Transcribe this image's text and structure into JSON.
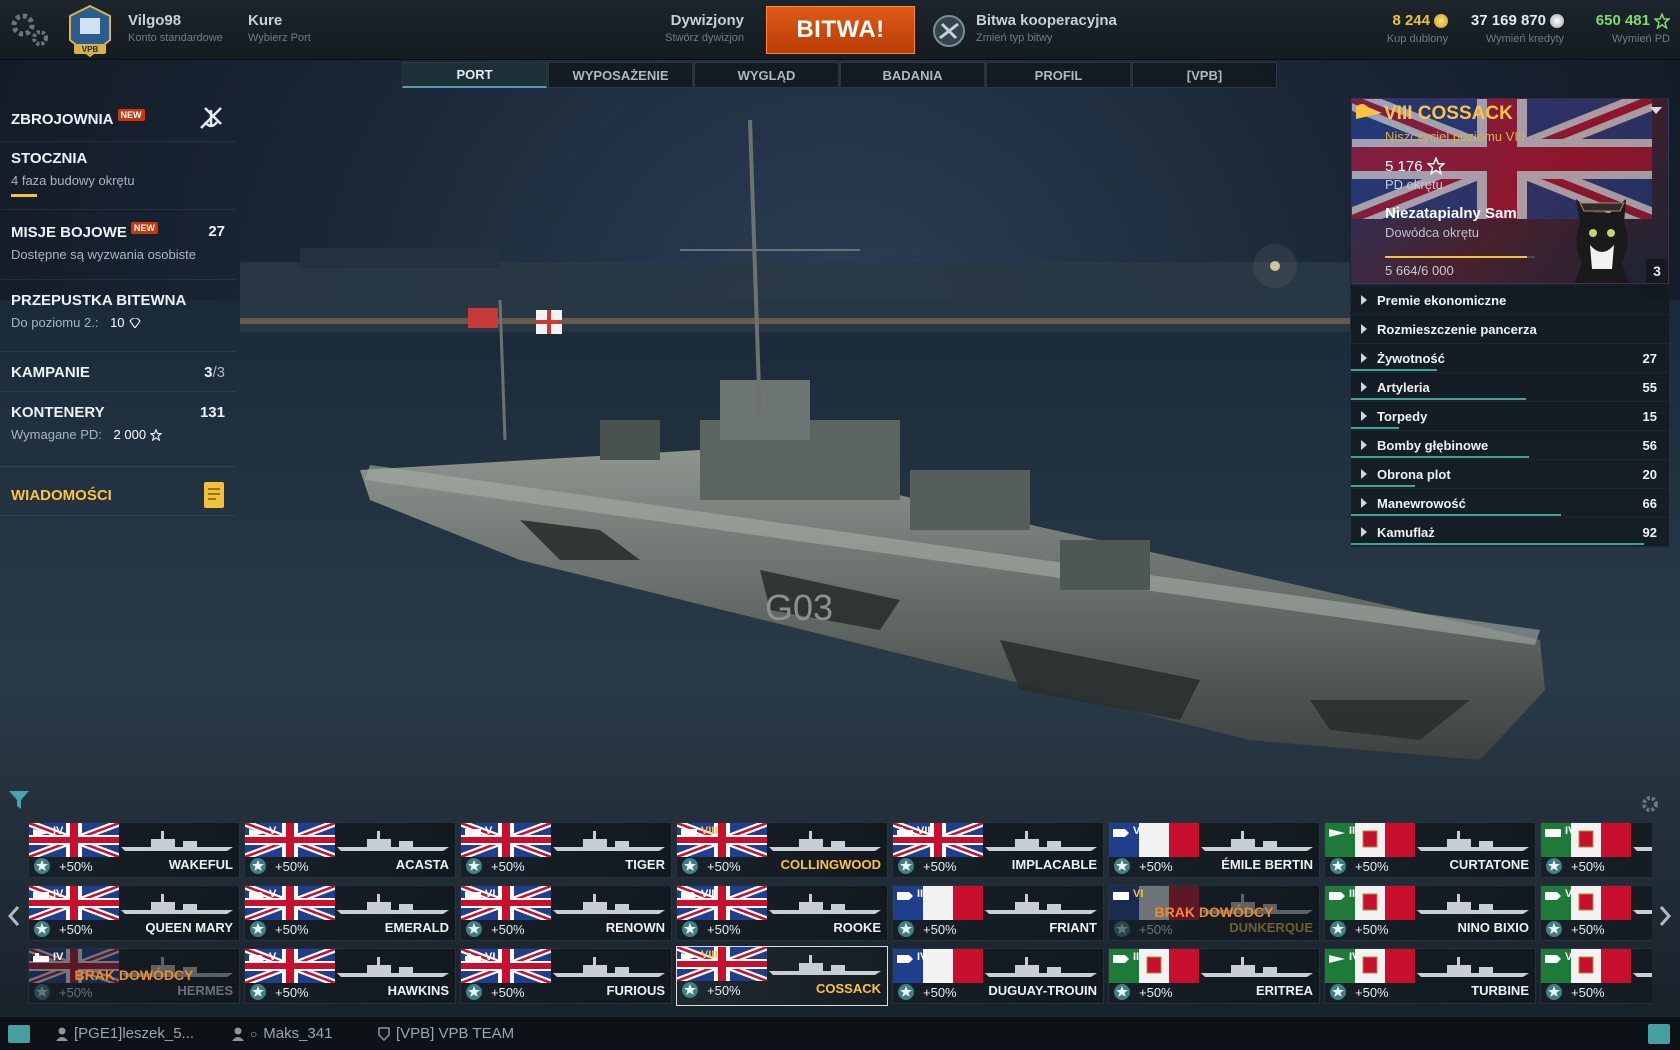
{
  "header": {
    "user": {
      "name": "Vilgo98",
      "sub": "Konto standardowe"
    },
    "port": {
      "name": "Kure",
      "sub": "Wybierz Port"
    },
    "division": {
      "label": "Dywizjony",
      "sub": "Stwórz dywizjon"
    },
    "battle_button": "BITWA!",
    "battle_type": {
      "label": "Bitwa kooperacyjna",
      "sub": "Zmień typ bitwy"
    },
    "currencies": [
      {
        "value": "8 244",
        "sub": "Kup dublony",
        "color": "#f2c13b",
        "icon": "doubloon-icon"
      },
      {
        "value": "37 169 870",
        "sub": "Wymień kredyty",
        "color": "#e6e9ec",
        "icon": "credits-icon"
      },
      {
        "value": "650 481",
        "sub": "Wymień PD",
        "color": "#7fdc6c",
        "icon": "free-xp-star-icon"
      }
    ],
    "clan_tag": "VPB"
  },
  "tabs": [
    "PORT",
    "WYPOSAŻENIE",
    "WYGLĄD",
    "BADANIA",
    "PROFIL",
    "[VPB]"
  ],
  "left_menu": {
    "zbrojownia": {
      "title": "ZBROJOWNIA",
      "badge": "NEW"
    },
    "stocznia": {
      "title": "STOCZNIA",
      "sub": "4 faza budowy okrętu"
    },
    "misje": {
      "title": "MISJE BOJOWE",
      "badge": "NEW",
      "count": "27",
      "sub": "Dostępne są wyzwania osobiste"
    },
    "przepustka": {
      "title": "PRZEPUSTKA BITEWNA",
      "sub_label": "Do poziomu 2.:",
      "sub_value": "10"
    },
    "kampanie": {
      "title": "KAMPANIE",
      "count": "3",
      "total": "/3"
    },
    "kontenery": {
      "title": "KONTENERY",
      "count": "131",
      "sub_label": "Wymagane PD:",
      "sub_value": "2 000"
    },
    "wiadomosci": {
      "title": "WIADOMOŚCI"
    }
  },
  "ship_panel": {
    "name": "VIII COSSACK",
    "class": "Niszczyciel poziomu VIII",
    "pd_value": "5 176",
    "pd_label": "PD okrętu",
    "commander_name": "Niezatapialny Sam",
    "commander_role": "Dowódca okrętu",
    "commander_xp": "5 664/6 000",
    "commander_xp_fraction": 0.944,
    "commander_level": "3",
    "stats": [
      {
        "label": "Premie ekonomiczne",
        "value": "",
        "fraction": 0
      },
      {
        "label": "Rozmieszczenie pancerza",
        "value": "",
        "fraction": 0
      },
      {
        "label": "Żywotność",
        "value": "27",
        "fraction": 0.27
      },
      {
        "label": "Artyleria",
        "value": "55",
        "fraction": 0.55
      },
      {
        "label": "Torpedy",
        "value": "15",
        "fraction": 0.15
      },
      {
        "label": "Bomby głębinowe",
        "value": "56",
        "fraction": 0.56
      },
      {
        "label": "Obrona plot",
        "value": "20",
        "fraction": 0.2
      },
      {
        "label": "Manewrowość",
        "value": "66",
        "fraction": 0.66
      },
      {
        "label": "Kamuflaż",
        "value": "92",
        "fraction": 0.92
      }
    ]
  },
  "ships": [
    {
      "tier": "IV",
      "name": "WAKEFUL",
      "bonus": "+50%",
      "nation": "uk",
      "type": "dd",
      "row": 0,
      "col": 0
    },
    {
      "tier": "V",
      "name": "ACASTA",
      "bonus": "+50%",
      "nation": "uk",
      "type": "dd",
      "row": 0,
      "col": 1
    },
    {
      "tier": "V",
      "name": "TIGER",
      "bonus": "+50%",
      "nation": "uk",
      "type": "bb",
      "premium_icon": true,
      "row": 0,
      "col": 2
    },
    {
      "tier": "VIII",
      "name": "COLLINGWOOD",
      "bonus": "+50%",
      "nation": "uk",
      "type": "bb",
      "premium": true,
      "row": 0,
      "col": 3
    },
    {
      "tier": "VIII",
      "name": "IMPLACABLE",
      "bonus": "+50%",
      "nation": "uk",
      "type": "cv",
      "row": 0,
      "col": 4
    },
    {
      "tier": "V",
      "name": "ÉMILE BERTIN",
      "bonus": "+50%",
      "nation": "fr",
      "type": "ca",
      "row": 0,
      "col": 5
    },
    {
      "tier": "II",
      "name": "CURTATONE",
      "bonus": "+50%",
      "nation": "it",
      "type": "dd",
      "row": 0,
      "col": 6
    },
    {
      "tier": "IV",
      "name": "",
      "bonus": "+50%",
      "nation": "it",
      "type": "bb",
      "row": 0,
      "col": 7
    },
    {
      "tier": "IV",
      "name": "QUEEN MARY",
      "bonus": "+50%",
      "nation": "uk",
      "type": "bb",
      "row": 1,
      "col": 0
    },
    {
      "tier": "V",
      "name": "EMERALD",
      "bonus": "+50%",
      "nation": "uk",
      "type": "ca",
      "row": 1,
      "col": 1
    },
    {
      "tier": "VI",
      "name": "RENOWN",
      "bonus": "+50%",
      "nation": "uk",
      "type": "bb",
      "row": 1,
      "col": 2
    },
    {
      "tier": "VII",
      "name": "ROOKE",
      "bonus": "+50%",
      "nation": "uk",
      "type": "ca",
      "row": 1,
      "col": 3
    },
    {
      "tier": "III",
      "name": "FRIANT",
      "bonus": "+50%",
      "nation": "fr",
      "type": "ca",
      "row": 1,
      "col": 4
    },
    {
      "tier": "VI",
      "name": "DUNKERQUE",
      "bonus": "+50%",
      "nation": "fr",
      "type": "bb",
      "premium": true,
      "no_commander": true,
      "warning": "BRAK DOWÓDCY",
      "row": 1,
      "col": 5
    },
    {
      "tier": "III",
      "name": "NINO BIXIO",
      "bonus": "+50%",
      "nation": "it",
      "type": "ca",
      "row": 1,
      "col": 6
    },
    {
      "tier": "V",
      "name": "",
      "bonus": "+50%",
      "nation": "it",
      "type": "ca",
      "row": 1,
      "col": 7
    },
    {
      "tier": "IV",
      "name": "HERMES",
      "bonus": "+50%",
      "nation": "uk",
      "type": "cv",
      "no_commander": true,
      "warning": "BRAK DOWÓDCY",
      "row": 2,
      "col": 0
    },
    {
      "tier": "V",
      "name": "HAWKINS",
      "bonus": "+50%",
      "nation": "uk",
      "type": "ca",
      "row": 2,
      "col": 1
    },
    {
      "tier": "VI",
      "name": "FURIOUS",
      "bonus": "+50%",
      "nation": "uk",
      "type": "cv",
      "row": 2,
      "col": 2
    },
    {
      "tier": "VIII",
      "name": "COSSACK",
      "bonus": "+50%",
      "nation": "uk",
      "type": "dd",
      "premium": true,
      "selected": true,
      "row": 2,
      "col": 3
    },
    {
      "tier": "IV",
      "name": "DUGUAY-TROUIN",
      "bonus": "+50%",
      "nation": "fr",
      "type": "ca",
      "row": 2,
      "col": 4
    },
    {
      "tier": "II",
      "name": "ERITREA",
      "bonus": "+50%",
      "nation": "it",
      "type": "ca",
      "row": 2,
      "col": 5
    },
    {
      "tier": "IV",
      "name": "TURBINE",
      "bonus": "+50%",
      "nation": "it",
      "type": "dd",
      "row": 2,
      "col": 6
    },
    {
      "tier": "V",
      "name": "",
      "bonus": "+50%",
      "nation": "it",
      "type": "ca",
      "row": 2,
      "col": 7
    }
  ],
  "bottom_bar": {
    "contacts": [
      "[PGE1]leszek_5...",
      "Maks_341",
      "[VPB] VPB TEAM"
    ]
  },
  "scene": {
    "hull_number": "G03"
  }
}
